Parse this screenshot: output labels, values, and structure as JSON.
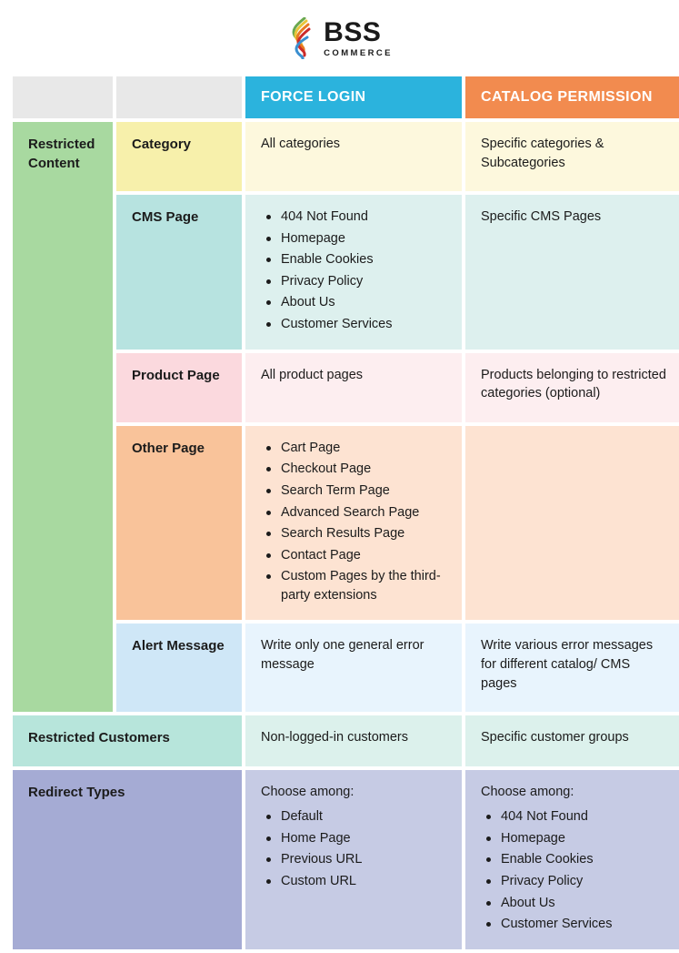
{
  "logo": {
    "name": "BSS",
    "tagline": "COMMERCE",
    "icon": "flame-icon"
  },
  "table": {
    "headers": {
      "blank_one": "",
      "blank_two": "",
      "force_login": "FORCE LOGIN",
      "catalog_permission": "CATALOG PERMISSION"
    },
    "groups": [
      {
        "label": "Restricted Content",
        "color": "#a8d9a0",
        "rows": [
          {
            "label": "Category",
            "label_color": "#f7f0ab",
            "cell_color": "#fdf8dd",
            "force_login": {
              "text": "All categories",
              "items": []
            },
            "catalog_permission": {
              "text": "Specific categories & Subcategories",
              "items": []
            }
          },
          {
            "label": "CMS Page",
            "label_color": "#b7e3e0",
            "cell_color": "#ddf0ee",
            "force_login": {
              "text": "",
              "items": [
                "404 Not Found",
                "Homepage",
                "Enable Cookies",
                "Privacy Policy",
                "About Us",
                "Customer Services"
              ]
            },
            "catalog_permission": {
              "text": "Specific CMS Pages",
              "items": []
            }
          },
          {
            "label": "Product Page",
            "label_color": "#fbd9de",
            "cell_color": "#fdeef0",
            "force_login": {
              "text": "All product pages",
              "items": []
            },
            "catalog_permission": {
              "text": "Products belonging to restricted categories (optional)",
              "items": []
            }
          },
          {
            "label": "Other Page",
            "label_color": "#f9c39a",
            "cell_color": "#fde3d2",
            "force_login": {
              "text": "",
              "items": [
                "Cart Page",
                "Checkout Page",
                "Search Term Page",
                "Advanced Search Page",
                "Search Results Page",
                "Contact Page",
                "Custom Pages by the third-party extensions"
              ]
            },
            "catalog_permission": {
              "text": "",
              "items": []
            }
          },
          {
            "label": "Alert Message",
            "label_color": "#cfe7f7",
            "cell_color": "#e8f4fd",
            "force_login": {
              "text": "Write only one general error message",
              "items": []
            },
            "catalog_permission": {
              "text": "Write various error messages for different catalog/ CMS pages",
              "items": []
            }
          }
        ]
      }
    ],
    "single_rows": [
      {
        "label": "Restricted Customers",
        "label_color": "#b7e5db",
        "cell_color": "#dcf1ec",
        "force_login": {
          "text": "Non-logged-in customers",
          "items": []
        },
        "catalog_permission": {
          "text": "Specific customer groups",
          "items": []
        }
      },
      {
        "label": "Redirect Types",
        "label_color": "#a5abd4",
        "cell_color": "#c6cbe4",
        "force_login": {
          "text": "Choose among:",
          "items": [
            "Default",
            "Home Page",
            "Previous URL",
            "Custom URL"
          ]
        },
        "catalog_permission": {
          "text": "Choose among:",
          "items": [
            "404 Not Found",
            "Homepage",
            "Enable Cookies",
            "Privacy Policy",
            "About Us",
            "Customer Services"
          ]
        }
      }
    ]
  },
  "colors": {
    "force_login_header": "#2bb3dd",
    "catalog_permission_header": "#f28b4f",
    "blank_header": "#e8e8e8",
    "text": "#1b1b1b"
  }
}
